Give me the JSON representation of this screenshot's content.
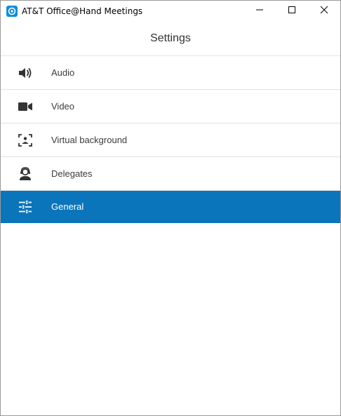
{
  "window": {
    "title": "AT&T Office@Hand Meetings",
    "controls": [
      "minimize-icon",
      "maximize-icon",
      "close-icon"
    ]
  },
  "header": {
    "title": "Settings"
  },
  "menu": {
    "items": [
      {
        "label": "Audio",
        "icon": "speaker-icon",
        "selected": false
      },
      {
        "label": "Video",
        "icon": "video-camera-icon",
        "selected": false
      },
      {
        "label": "Virtual background",
        "icon": "virtual-background-icon",
        "selected": false
      },
      {
        "label": "Delegates",
        "icon": "headset-person-icon",
        "selected": false
      },
      {
        "label": "General",
        "icon": "sliders-icon",
        "selected": true
      }
    ]
  },
  "colors": {
    "accent": "#0a75bb",
    "app_icon": "#0f8fd6",
    "text": "#333333",
    "divider": "#e2e2e2"
  }
}
